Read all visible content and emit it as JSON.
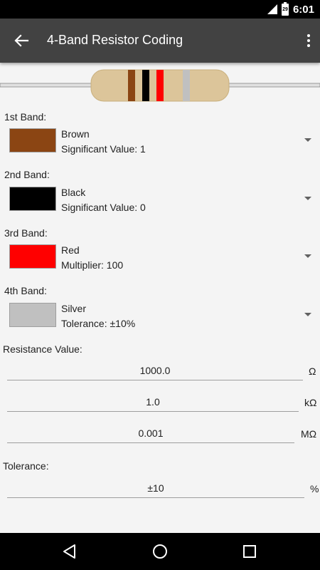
{
  "status_bar": {
    "time": "6:01",
    "battery_level": "29"
  },
  "app_bar": {
    "title": "4-Band Resistor Coding",
    "back_icon": "arrow-back-icon",
    "menu_icon": "more-vert-icon"
  },
  "bands": [
    {
      "label": "1st Band:",
      "color_name": "Brown",
      "detail": "Significant Value: 1",
      "color": "#8B4513"
    },
    {
      "label": "2nd Band:",
      "color_name": "Black",
      "detail": "Significant Value: 0",
      "color": "#000000"
    },
    {
      "label": "3rd Band:",
      "color_name": "Red",
      "detail": "Multiplier: 100",
      "color": "#FF0000"
    },
    {
      "label": "4th Band:",
      "color_name": "Silver",
      "detail": "Tolerance: ±10%",
      "color": "#C0C0C0"
    }
  ],
  "resistance": {
    "label": "Resistance Value:",
    "fields": [
      {
        "value": "1000.0",
        "unit": "Ω"
      },
      {
        "value": "1.0",
        "unit": "kΩ"
      },
      {
        "value": "0.001",
        "unit": "MΩ"
      }
    ]
  },
  "tolerance": {
    "label": "Tolerance:",
    "value": "±10",
    "unit": "%"
  },
  "colors": {
    "app_bar": "#424242",
    "body_tan": "#DCC59A",
    "lead": "#E0E0E0"
  }
}
